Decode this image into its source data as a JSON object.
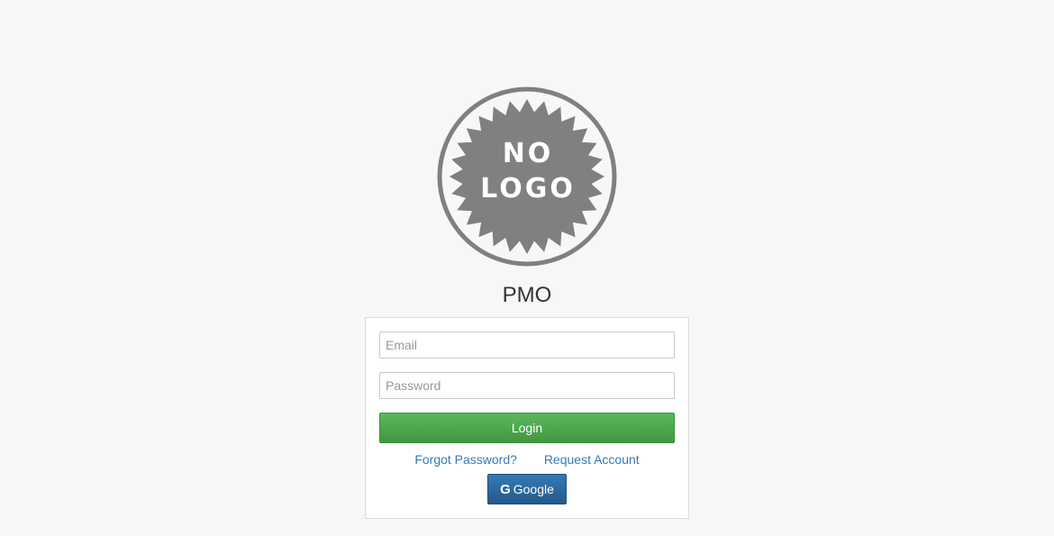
{
  "logo": {
    "line1": "NO",
    "line2": "LOGO",
    "color": "#808080"
  },
  "app": {
    "title": "PMO"
  },
  "login_form": {
    "email_placeholder": "Email",
    "email_value": "",
    "password_placeholder": "Password",
    "password_value": "",
    "login_label": "Login",
    "forgot_password_label": "Forgot Password?",
    "request_account_label": "Request Account",
    "google_label": "Google",
    "google_icon": "google-g-icon"
  },
  "colors": {
    "background": "#f7f7f7",
    "login_button": "#4cae4c",
    "google_button": "#2c6ca8",
    "link": "#337ab7"
  }
}
